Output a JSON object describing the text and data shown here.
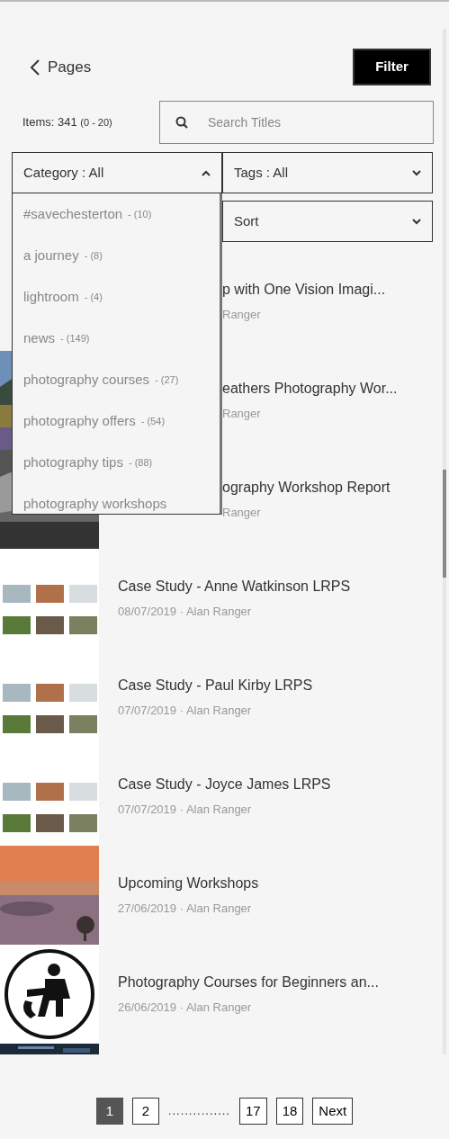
{
  "header": {
    "back_label": "Pages",
    "filter_button": "Filter"
  },
  "items_count": {
    "label": "Items: 341",
    "range": "(0 - 20)"
  },
  "search": {
    "placeholder": "Search Titles"
  },
  "filters": [
    {
      "label": "Category : All",
      "expanded": true
    },
    {
      "label": "Tags : All",
      "expanded": false
    },
    {
      "label": "Sort",
      "expanded": false
    }
  ],
  "category_options": [
    {
      "name": "#savechesterton",
      "count": "- (10)"
    },
    {
      "name": "a journey",
      "count": "- (8)"
    },
    {
      "name": "lightroom",
      "count": "- (4)"
    },
    {
      "name": "news",
      "count": "- (149)"
    },
    {
      "name": "photography courses",
      "count": "- (27)"
    },
    {
      "name": "photography offers",
      "count": "- (54)"
    },
    {
      "name": "photography tips",
      "count": "- (88)"
    },
    {
      "name": "photography workshops"
    }
  ],
  "posts": [
    {
      "title": "p with One Vision Imagi...",
      "meta": "Ranger",
      "partly_hidden": true,
      "kind": "none"
    },
    {
      "title": "eathers Photography Wor...",
      "meta": "Ranger",
      "partly_hidden": true,
      "kind": "picture"
    },
    {
      "title": "ography Workshop Report",
      "meta": "Ranger",
      "partly_hidden": true,
      "kind": "picture"
    },
    {
      "title": "Case Study - Anne Watkinson LRPS",
      "meta": "08/07/2019 · Alan Ranger",
      "partly_hidden": false,
      "kind": "picture"
    },
    {
      "title": "Case Study - Paul Kirby LRPS",
      "meta": "07/07/2019 · Alan Ranger",
      "partly_hidden": false,
      "kind": "picture"
    },
    {
      "title": "Case Study - Joyce James LRPS",
      "meta": "07/07/2019 · Alan Ranger",
      "partly_hidden": false,
      "kind": "picture"
    },
    {
      "title": "Upcoming Workshops",
      "meta": "27/06/2019 · Alan Ranger",
      "partly_hidden": false,
      "kind": "picture"
    },
    {
      "title": "Photography Courses for Beginners an...",
      "meta": "26/06/2019 · Alan Ranger",
      "partly_hidden": false,
      "kind": "logo"
    }
  ],
  "pagination": {
    "pages": [
      {
        "label": "1",
        "selected": true
      },
      {
        "label": "2",
        "selected": false
      },
      {
        "label": "...............",
        "kind": "gap"
      },
      {
        "label": "17",
        "selected": false
      },
      {
        "label": "18",
        "selected": false
      },
      {
        "label": "Next",
        "selected": false
      }
    ]
  }
}
